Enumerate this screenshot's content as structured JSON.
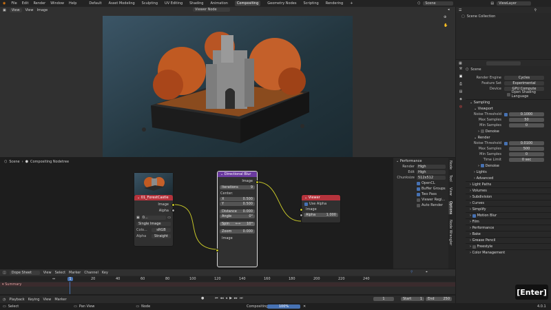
{
  "topbar": {
    "menus": [
      "File",
      "Edit",
      "Render",
      "Window",
      "Help"
    ],
    "workspaces": [
      "Default",
      "Asset Modeling",
      "Sculpting",
      "UV Editing",
      "Shading",
      "Animation",
      "Compositing",
      "Geometry Nodes",
      "Scripting",
      "Rendering"
    ],
    "active_workspace": "Compositing",
    "scene": "Scene",
    "view_layer": "ViewLayer"
  },
  "image_editor": {
    "menus": [
      "View",
      "View",
      "Image"
    ],
    "viewer": "Viewer Node"
  },
  "node_editor": {
    "breadcrumb_scene": "Scene",
    "breadcrumb_tree": "Compositing Nodetree",
    "image_node": {
      "title": "01_ForestCastle",
      "out_image": "Image",
      "out_alpha": "Alpha",
      "img_name": "0...",
      "source": "Single Image",
      "color_label": "Colo...",
      "color_value": "sRGB",
      "alpha_label": "Alpha",
      "alpha_value": "Straight"
    },
    "blur_node": {
      "title": "Directional Blur",
      "out_image": "Image",
      "iterations_label": "Iterations",
      "iterations": "9",
      "center_label": "Center:",
      "x_label": "X",
      "x": "0.500",
      "y_label": "Y",
      "y": "0.500",
      "distance_label": "Distance",
      "distance": "0.000",
      "angle_label": "Angle",
      "angle": "0°",
      "spin_label": "Spin",
      "spin": "10°",
      "zoom_label": "Zoom",
      "zoom": "0.000",
      "in_image": "Image"
    },
    "viewer_node": {
      "title": "Viewer",
      "use_alpha": "Use Alpha",
      "in_image": "Image",
      "in_alpha": "Alpha",
      "alpha": "1.000"
    }
  },
  "performance": {
    "title": "Performance",
    "render_label": "Render",
    "render": "High",
    "edit_label": "Edit",
    "edit": "High",
    "chunksize_label": "Chunksize",
    "chunksize": "512x512",
    "opencl": "OpenCL",
    "buffer_groups": "Buffer Groups",
    "two_pass": "Two Pass",
    "viewer_region": "Viewer Regi...",
    "auto_render": "Auto Render",
    "tabs": [
      "Node",
      "Tool",
      "View",
      "Options",
      "Node Wrangler"
    ]
  },
  "outliner": {
    "item": "Scene Collection"
  },
  "properties": {
    "scene": "Scene",
    "render_engine_label": "Render Engine",
    "render_engine": "Cycles",
    "feature_set_label": "Feature Set",
    "feature_set": "Experimental",
    "device_label": "Device",
    "device": "GPU Compute",
    "osl": "Open Shading Language",
    "sampling": "Sampling",
    "viewport": "Viewport",
    "noise_threshold_label": "Noise Threshold",
    "viewport_noise": "0.1000",
    "max_samples_label": "Max Samples",
    "viewport_max": "50",
    "min_samples_label": "Min Samples",
    "viewport_min": "0",
    "denoise": "Denoise",
    "render": "Render",
    "render_noise": "0.0100",
    "render_max": "500",
    "render_min": "0",
    "time_limit_label": "Time Limit",
    "time_limit": "0 sec",
    "denoise2": "Denoise",
    "lights": "Lights",
    "advanced": "Advanced",
    "sections": [
      "Light Paths",
      "Volumes",
      "Subdivision",
      "Curves",
      "Simplify",
      "Motion Blur",
      "Film",
      "Performance",
      "Bake",
      "Grease Pencil",
      "Freestyle",
      "Color Management"
    ]
  },
  "dopesheet": {
    "mode": "Dope Sheet",
    "menus": [
      "View",
      "Select",
      "Marker",
      "Channel",
      "Key"
    ],
    "summary": "Summary",
    "frames": [
      "1",
      "20",
      "40",
      "60",
      "80",
      "100",
      "120",
      "140",
      "160",
      "180",
      "200",
      "220",
      "240"
    ],
    "current": "1"
  },
  "timeline": {
    "menus": [
      "Playback",
      "Keying",
      "View",
      "Marker"
    ],
    "frame": "1",
    "start_label": "Start",
    "start": "1",
    "end_label": "End",
    "end": "250"
  },
  "statusbar": {
    "select": "Select",
    "pan": "Pan View",
    "node": "Node",
    "compositing": "Compositing",
    "progress": "100%",
    "version": "4.0.1"
  },
  "overlay": {
    "key": "[Enter]"
  },
  "colors": {
    "accent": "#4772b3",
    "image_header": "#b5333c",
    "blur_header": "#6b3aa0",
    "viewer_header": "#b5333c"
  }
}
